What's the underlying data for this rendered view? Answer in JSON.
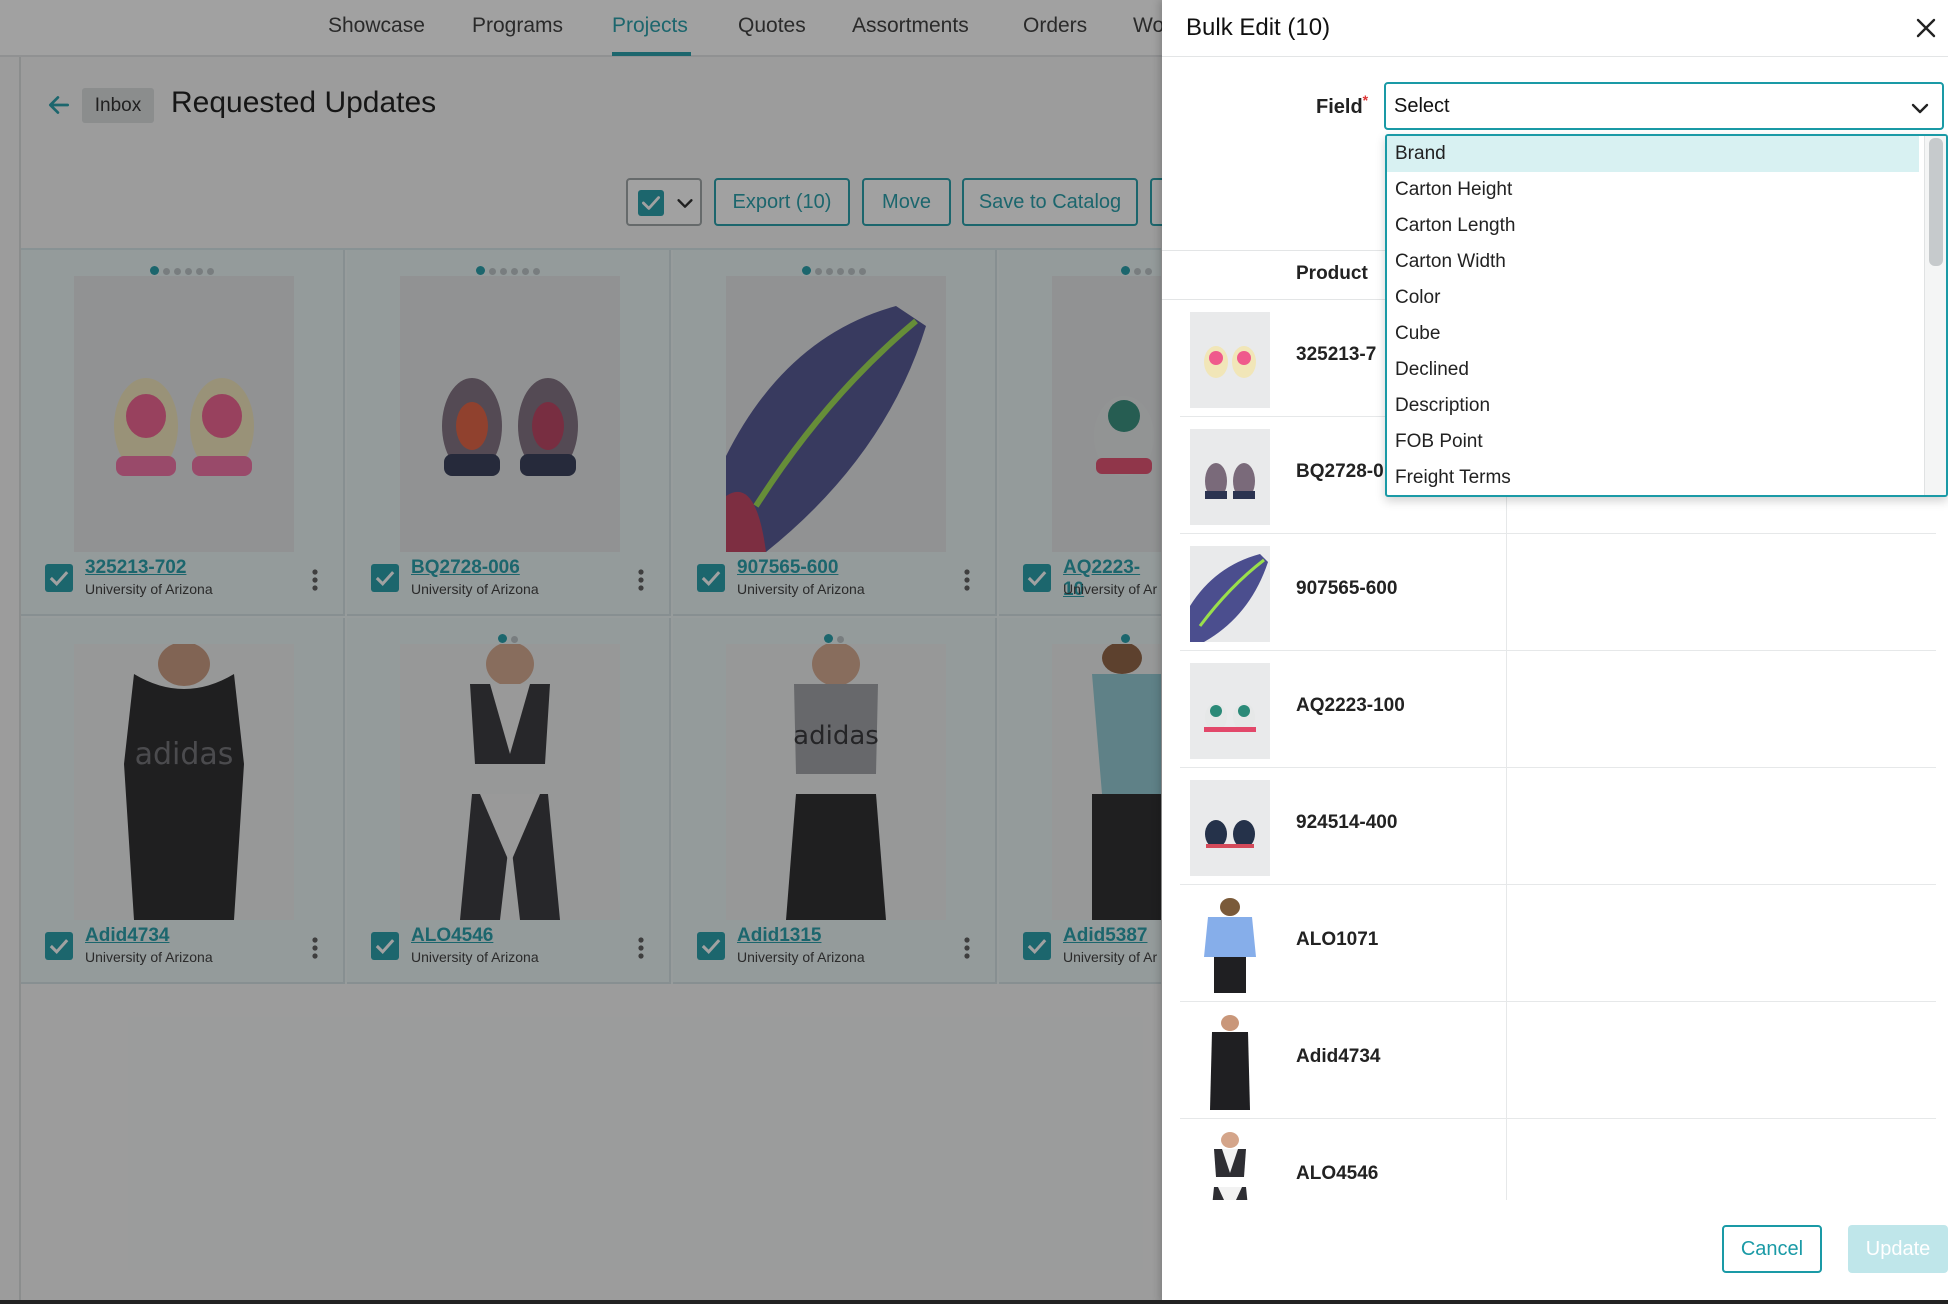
{
  "nav": {
    "tabs": [
      {
        "label": "Showcase"
      },
      {
        "label": "Programs"
      },
      {
        "label": "Projects",
        "active": true
      },
      {
        "label": "Quotes"
      },
      {
        "label": "Assortments"
      },
      {
        "label": "Orders"
      },
      {
        "label": "Wo"
      }
    ]
  },
  "header": {
    "breadcrumb": "Inbox",
    "title": "Requested Updates"
  },
  "toolbar": {
    "export_label": "Export (10)",
    "move_label": "Move",
    "save_label": "Save to Catalog"
  },
  "grid": {
    "cards": [
      {
        "sku": "325213-702",
        "org": "University of Arizona"
      },
      {
        "sku": "BQ2728-006",
        "org": "University of Arizona"
      },
      {
        "sku": "907565-600",
        "org": "University of Arizona"
      },
      {
        "sku": "AQ2223-10",
        "org": "University of Ar"
      },
      {
        "sku": "Adid4734",
        "org": "University of Arizona"
      },
      {
        "sku": "ALO4546",
        "org": "University of Arizona"
      },
      {
        "sku": "Adid1315",
        "org": "University of Arizona"
      },
      {
        "sku": "Adid5387",
        "org": "University of Ar"
      }
    ]
  },
  "drawer": {
    "title": "Bulk Edit (10)",
    "field_label": "Field",
    "required_mark": "*",
    "select_value": "Select",
    "column_header": "Product",
    "dropdown_options": [
      "Brand",
      "Carton Height",
      "Carton Length",
      "Carton Width",
      "Color",
      "Cube",
      "Declined",
      "Description",
      "FOB Point",
      "Freight Terms"
    ],
    "rows": [
      {
        "sku": "325213-7"
      },
      {
        "sku": "BQ2728-0"
      },
      {
        "sku": "907565-600"
      },
      {
        "sku": "AQ2223-100"
      },
      {
        "sku": "924514-400"
      },
      {
        "sku": "ALO1071"
      },
      {
        "sku": "Adid4734"
      },
      {
        "sku": "ALO4546"
      }
    ],
    "cancel_label": "Cancel",
    "update_label": "Update"
  },
  "colors": {
    "accent": "#1a9aa6",
    "highlight": "#d8f1f2"
  }
}
